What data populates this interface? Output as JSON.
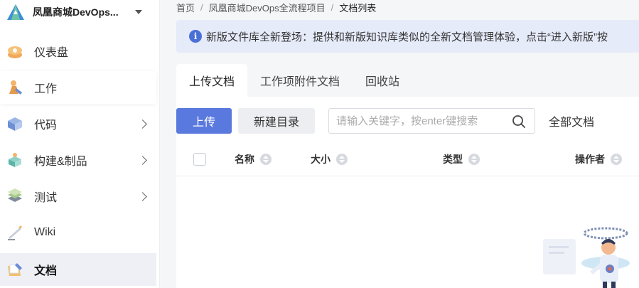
{
  "project": {
    "name": "凤凰商城DevOps..."
  },
  "sidebar": {
    "items": [
      {
        "label": "仪表盘",
        "icon": "dashboard-icon"
      },
      {
        "label": "工作",
        "icon": "work-icon"
      },
      {
        "label": "代码",
        "icon": "code-icon"
      },
      {
        "label": "构建&制品",
        "icon": "build-icon"
      },
      {
        "label": "测试",
        "icon": "test-icon"
      },
      {
        "label": "Wiki",
        "icon": "wiki-icon"
      },
      {
        "label": "文档",
        "icon": "docs-icon"
      }
    ]
  },
  "breadcrumb": {
    "items": [
      "首页",
      "凤凰商城DevOps全流程项目",
      "文档列表"
    ],
    "separator": "/"
  },
  "notice": {
    "text": "新版文件库全新登场：提供和新版知识库类似的全新文档管理体验，点击“进入新版”按"
  },
  "tabs": [
    "上传文档",
    "工作项附件文档",
    "回收站"
  ],
  "toolbar": {
    "upload_label": "上传",
    "new_dir_label": "新建目录",
    "search_placeholder": "请输入关键字，按enter键搜索",
    "filter_label": "全部文档"
  },
  "table": {
    "columns": [
      "名称",
      "大小",
      "类型",
      "操作者"
    ]
  },
  "colors": {
    "accent": "#5a79de",
    "notice_bg": "#e6ebfa",
    "active_nav_bg": "#eef0f5"
  }
}
